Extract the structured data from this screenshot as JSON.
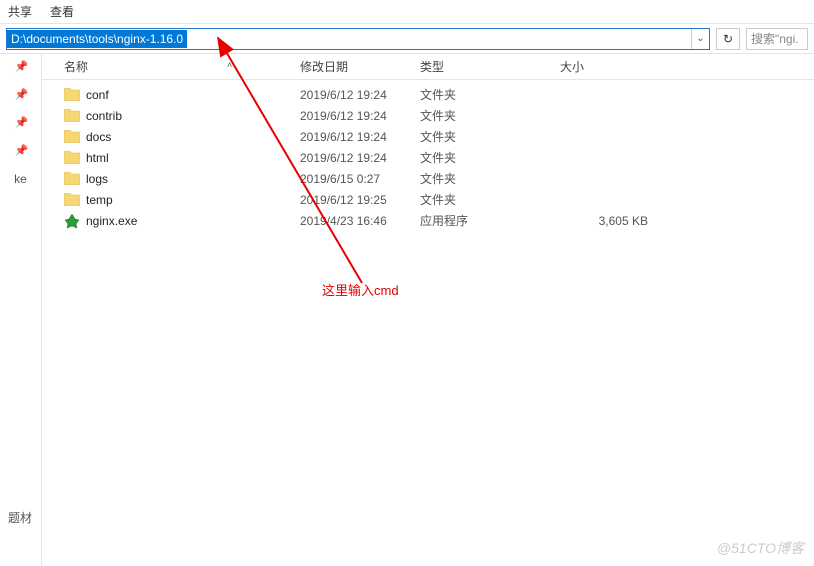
{
  "menu": {
    "share": "共享",
    "view": "查看"
  },
  "address": {
    "path": "D:\\documents\\tools\\nginx-1.16.0"
  },
  "search": {
    "placeholder": "搜索\"ngi."
  },
  "sidebar": {
    "labels": [
      "ke",
      "题材"
    ]
  },
  "columns": {
    "name": "名称",
    "date": "修改日期",
    "type": "类型",
    "size": "大小"
  },
  "rows": [
    {
      "name": "conf",
      "date": "2019/6/12 19:24",
      "type": "文件夹",
      "size": "",
      "icon": "folder"
    },
    {
      "name": "contrib",
      "date": "2019/6/12 19:24",
      "type": "文件夹",
      "size": "",
      "icon": "folder"
    },
    {
      "name": "docs",
      "date": "2019/6/12 19:24",
      "type": "文件夹",
      "size": "",
      "icon": "folder"
    },
    {
      "name": "html",
      "date": "2019/6/12 19:24",
      "type": "文件夹",
      "size": "",
      "icon": "folder"
    },
    {
      "name": "logs",
      "date": "2019/6/15 0:27",
      "type": "文件夹",
      "size": "",
      "icon": "folder"
    },
    {
      "name": "temp",
      "date": "2019/6/12 19:25",
      "type": "文件夹",
      "size": "",
      "icon": "folder"
    },
    {
      "name": "nginx.exe",
      "date": "2019/4/23 16:46",
      "type": "应用程序",
      "size": "3,605 KB",
      "icon": "exe"
    }
  ],
  "annotation": {
    "text": "这里输入cmd"
  },
  "watermark": "@51CTO博客"
}
